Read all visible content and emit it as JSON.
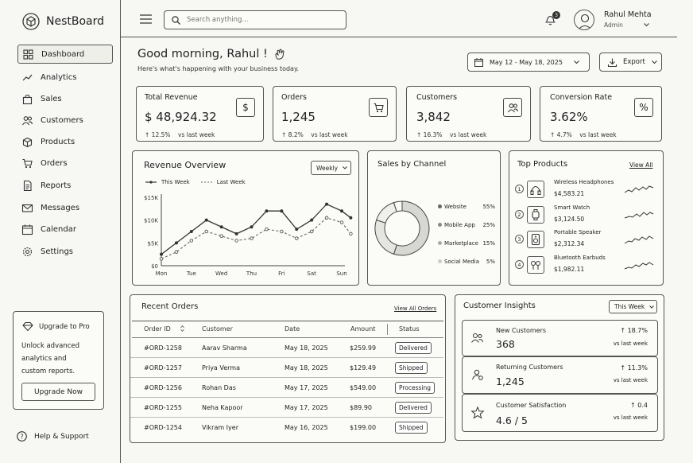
{
  "brand": {
    "name": "NestBoard"
  },
  "search": {
    "placeholder": "Search anything..."
  },
  "notifications": {
    "count": "3"
  },
  "user": {
    "name": "Rahul Mehta",
    "role": "Admin"
  },
  "sidebar": {
    "items": [
      {
        "label": "Dashboard",
        "icon": "grid-icon"
      },
      {
        "label": "Analytics",
        "icon": "trend-icon"
      },
      {
        "label": "Sales",
        "icon": "bag-icon"
      },
      {
        "label": "Customers",
        "icon": "users-icon"
      },
      {
        "label": "Products",
        "icon": "box-icon"
      },
      {
        "label": "Orders",
        "icon": "cart-icon"
      },
      {
        "label": "Reports",
        "icon": "document-icon"
      },
      {
        "label": "Messages",
        "icon": "mail-icon"
      },
      {
        "label": "Calendar",
        "icon": "calendar-icon"
      },
      {
        "label": "Settings",
        "icon": "gear-icon"
      }
    ],
    "upgrade": {
      "title": "Upgrade to Pro",
      "text": [
        "Unlock advanced",
        "analytics and",
        "custom reports."
      ],
      "button": "Upgrade Now"
    },
    "help": "Help & Support"
  },
  "greeting": {
    "title": "Good morning, Rahul !",
    "subtitle": "Here's what's happening with your business today."
  },
  "date_range": "May 12 - May 18, 2025",
  "export": "Export",
  "kpis": [
    {
      "title": "Total Revenue",
      "value": "$ 48,924.32",
      "delta": "↑ 12.5%",
      "compare": "vs last week",
      "icon": "dollar-icon"
    },
    {
      "title": "Orders",
      "value": "1,245",
      "delta": "↑ 8.2%",
      "compare": "vs last week",
      "icon": "cart-icon"
    },
    {
      "title": "Customers",
      "value": "3,842",
      "delta": "↑ 16.3%",
      "compare": "vs last week",
      "icon": "users-icon"
    },
    {
      "title": "Conversion Rate",
      "value": "3.62%",
      "delta": "↑ 4.7%",
      "compare": "vs last week",
      "icon": "percent-icon"
    }
  ],
  "revenue": {
    "title": "Revenue Overview",
    "period": "Weekly",
    "legend": {
      "this_week": "This Week",
      "last_week": "Last Week"
    }
  },
  "chart_data": [
    {
      "type": "line",
      "title": "Revenue Overview",
      "categories": [
        "Mon",
        "Tue",
        "Wed",
        "Thu",
        "Fri",
        "Sat",
        "Sun"
      ],
      "y_ticks": [
        "$15K",
        "$10K",
        "$5K",
        "$0"
      ],
      "ylim": [
        0,
        15000
      ],
      "x": [
        0,
        0.5,
        1,
        1.5,
        2,
        2.5,
        3,
        3.5,
        4,
        4.5,
        5,
        5.5,
        6,
        6.3
      ],
      "series": [
        {
          "name": "This Week",
          "values": [
            2500,
            5000,
            7500,
            10000,
            8500,
            7000,
            8500,
            12000,
            12000,
            8000,
            10000,
            13500,
            12000,
            10500
          ]
        },
        {
          "name": "Last Week",
          "values": [
            1500,
            3000,
            5500,
            7500,
            6500,
            5500,
            6000,
            8000,
            7500,
            6000,
            7500,
            10500,
            9500,
            7000
          ]
        }
      ],
      "grid": false,
      "legend": "top-left"
    },
    {
      "type": "pie",
      "title": "Sales by Channel",
      "categories": [
        "Website",
        "Mobile App",
        "Marketplace",
        "Social Media"
      ],
      "values": [
        55,
        25,
        15,
        5
      ]
    }
  ],
  "channels": {
    "title": "Sales by Channel",
    "items": [
      {
        "label": "Website",
        "value": "55%"
      },
      {
        "label": "Mobile App",
        "value": "25%"
      },
      {
        "label": "Marketplace",
        "value": "15%"
      },
      {
        "label": "Social Media",
        "value": "5%"
      }
    ]
  },
  "top_products": {
    "title": "Top Products",
    "link": "View All",
    "items": [
      {
        "rank": "1",
        "name": "Wireless Headphones",
        "price": "$4,583.21",
        "icon": "headphones-icon"
      },
      {
        "rank": "2",
        "name": "Smart Watch",
        "price": "$3,124.50",
        "icon": "watch-icon"
      },
      {
        "rank": "3",
        "name": "Portable Speaker",
        "price": "$2,312.34",
        "icon": "speaker-icon"
      },
      {
        "rank": "4",
        "name": "Bluetooth Earbuds",
        "price": "$1,982.11",
        "icon": "earbuds-icon"
      }
    ]
  },
  "orders": {
    "title": "Recent Orders",
    "link": "View All Orders",
    "headers": [
      "Order ID",
      "Customer",
      "Date",
      "Amount",
      "Status"
    ],
    "rows": [
      {
        "id": "#ORD-1258",
        "customer": "Aarav Sharma",
        "date": "May 18, 2025",
        "amount": "$259.99",
        "status": "Delivered"
      },
      {
        "id": "#ORD-1257",
        "customer": "Priya Verma",
        "date": "May 18, 2025",
        "amount": "$129.49",
        "status": "Shipped"
      },
      {
        "id": "#ORD-1256",
        "customer": "Rohan Das",
        "date": "May 17, 2025",
        "amount": "$549.00",
        "status": "Processing"
      },
      {
        "id": "#ORD-1255",
        "customer": "Neha Kapoor",
        "date": "May 17, 2025",
        "amount": "$89.90",
        "status": "Delivered"
      },
      {
        "id": "#ORD-1254",
        "customer": "Vikram Iyer",
        "date": "May 16, 2025",
        "amount": "$199.00",
        "status": "Shipped"
      }
    ]
  },
  "insights": {
    "title": "Customer Insights",
    "period": "This Week",
    "items": [
      {
        "label": "New Customers",
        "value": "368",
        "delta": "↑ 18.7%",
        "compare": "vs last week",
        "icon": "users-icon"
      },
      {
        "label": "Returning Customers",
        "value": "1,245",
        "delta": "↑ 11.3%",
        "compare": "vs last week",
        "icon": "user-return-icon"
      },
      {
        "label": "Customer Satisfaction",
        "value": "4.6 / 5",
        "delta": "↑ 0.4",
        "compare": "vs last week",
        "icon": "star-icon"
      }
    ]
  }
}
